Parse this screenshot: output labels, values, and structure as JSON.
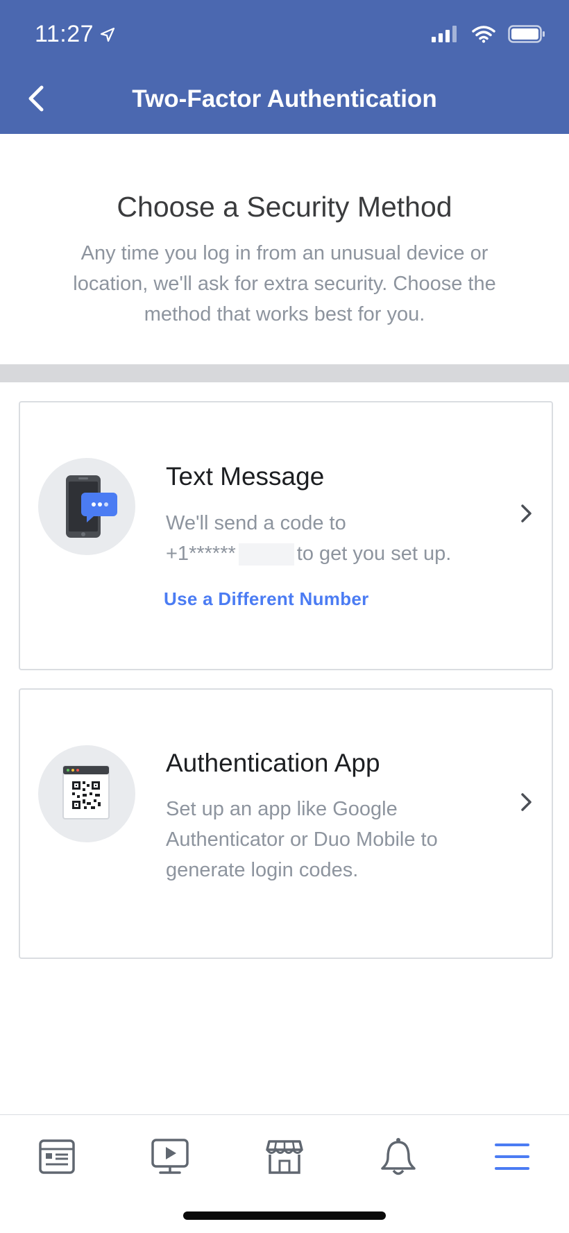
{
  "status_bar": {
    "time": "11:27"
  },
  "header": {
    "title": "Two-Factor Authentication",
    "back_icon": "chevron-left-icon"
  },
  "intro": {
    "title": "Choose a Security Method",
    "description": "Any time you log in from an unusual device or location, we'll ask for extra security. Choose the method that works best for you."
  },
  "methods": [
    {
      "title": "Text Message",
      "desc_line1": "We'll send a code to",
      "phone_prefix": "+1******",
      "desc_line2_suffix": "to get you set up.",
      "link": "Use a Different Number",
      "icon": "phone-message-icon"
    },
    {
      "title": "Authentication App",
      "description": "Set up an app like Google Authenticator or Duo Mobile to generate login codes.",
      "icon": "qr-code-app-icon"
    }
  ],
  "tabbar": {
    "items": [
      "news-feed-icon",
      "watch-icon",
      "marketplace-icon",
      "notifications-icon",
      "menu-icon"
    ],
    "active": "menu-icon"
  },
  "colors": {
    "header_bg": "#4b68b0",
    "link": "#4b7cf3",
    "active_tab": "#4b7cf3"
  }
}
